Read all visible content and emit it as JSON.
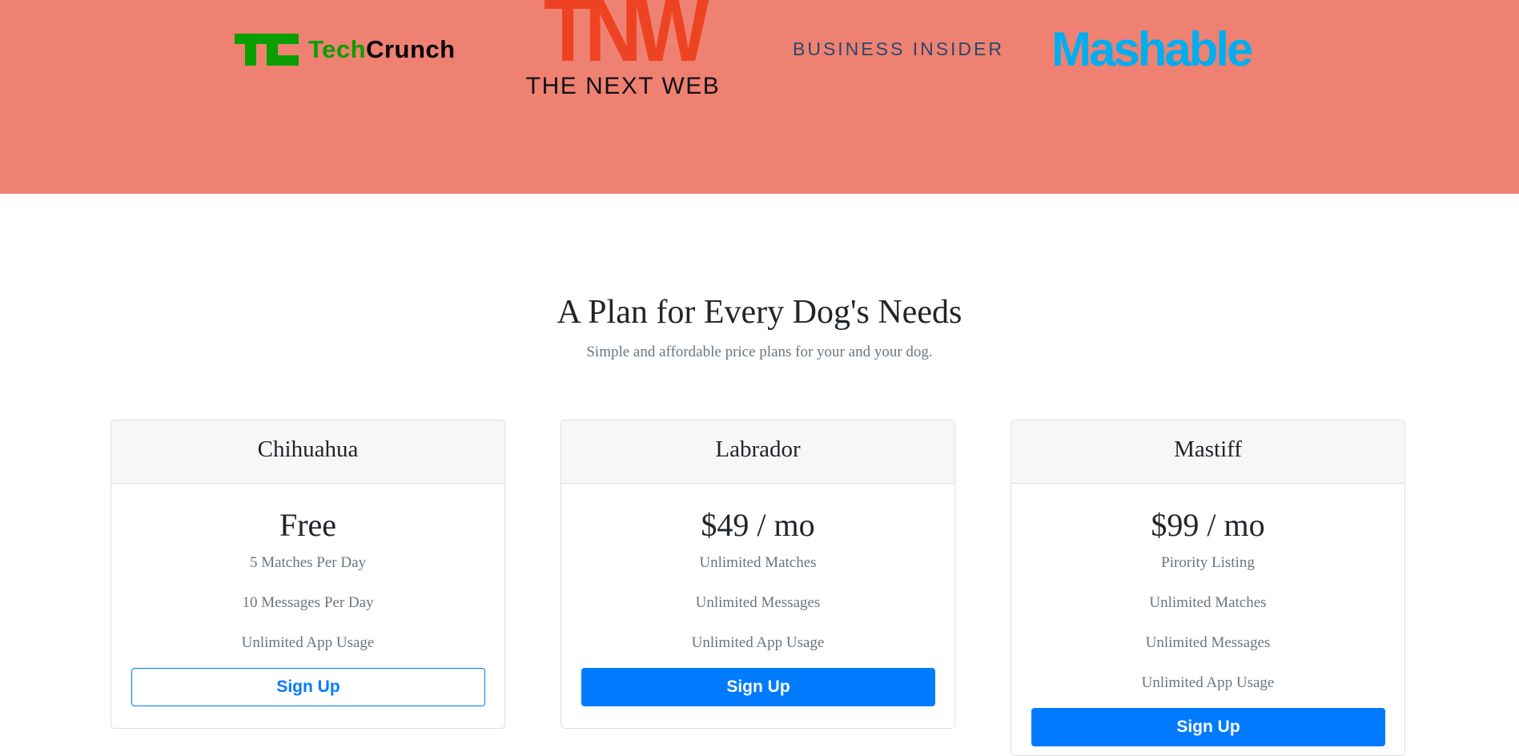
{
  "press": {
    "background": "#ef8172",
    "logos": {
      "techcrunch": {
        "part1": "Tech",
        "part2": "Crunch"
      },
      "tnw": {
        "letters": "TNW",
        "sub": "THE NEXT WEB"
      },
      "business_insider": "BUSINESS INSIDER",
      "mashable": "Mashable"
    }
  },
  "pricing": {
    "title": "A Plan for Every Dog's Needs",
    "subtitle": "Simple and affordable price plans for your and your dog.",
    "plans": [
      {
        "name": "Chihuahua",
        "price": "Free",
        "features": [
          "5 Matches Per Day",
          "10 Messages Per Day",
          "Unlimited App Usage"
        ],
        "button": "Sign Up",
        "button_style": "outline"
      },
      {
        "name": "Labrador",
        "price": "$49 / mo",
        "features": [
          "Unlimited Matches",
          "Unlimited Messages",
          "Unlimited App Usage"
        ],
        "button": "Sign Up",
        "button_style": "solid"
      },
      {
        "name": "Mastiff",
        "price": "$99 / mo",
        "features": [
          "Pirority Listing",
          "Unlimited Matches",
          "Unlimited Messages",
          "Unlimited App Usage"
        ],
        "button": "Sign Up",
        "button_style": "solid"
      }
    ]
  },
  "colors": {
    "accent": "#007bff",
    "techcrunch_green": "#0a9e01",
    "tnw_red": "#ee4322",
    "business_insider_blue": "#28496b",
    "mashable_blue": "#00aeef"
  }
}
